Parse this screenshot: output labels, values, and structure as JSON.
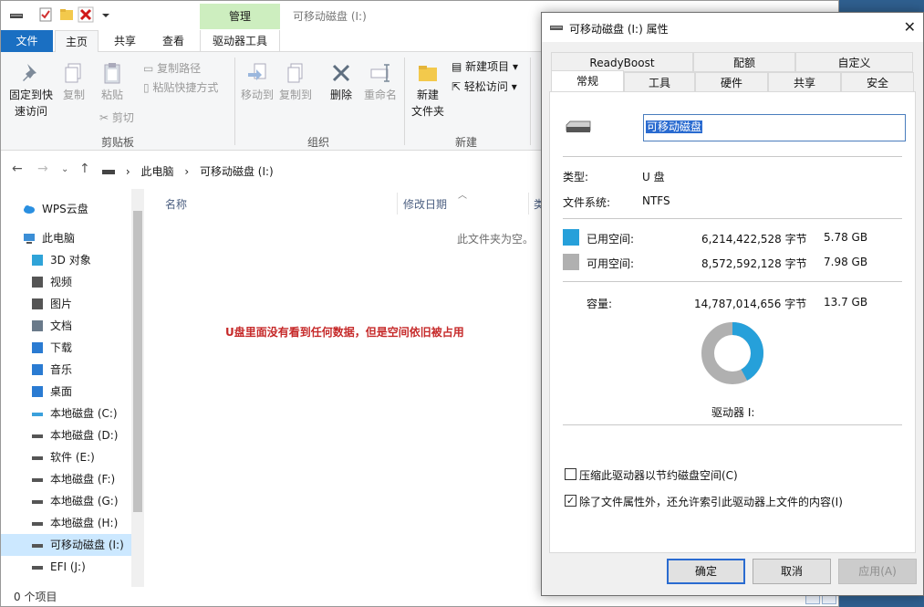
{
  "explorer": {
    "title": "可移动磁盘 (I:)",
    "manage_tab": "管理",
    "tabs": {
      "file": "文件",
      "home": "主页",
      "share": "共享",
      "view": "查看",
      "drive_tools": "驱动器工具"
    },
    "ribbon": {
      "clipboard": {
        "pin_line1": "固定到快",
        "pin_line2": "速访问",
        "copy": "复制",
        "paste": "粘贴",
        "copy_path": "复制路径",
        "paste_shortcut": "粘贴快捷方式",
        "cut": "剪切",
        "group_label": "剪贴板"
      },
      "organize": {
        "move_to": "移动到",
        "copy_to": "复制到",
        "delete": "删除",
        "rename": "重命名",
        "group_label": "组织"
      },
      "new": {
        "new_folder_line1": "新建",
        "new_folder_line2": "文件夹",
        "new_item": "新建项目",
        "easy_access": "轻松访问",
        "group_label": "新建"
      }
    },
    "address": {
      "segments": [
        "此电脑",
        "可移动磁盘 (I:)"
      ],
      "separator": "›"
    },
    "nav": {
      "wps": "WPS云盘",
      "this_pc": "此电脑",
      "items": [
        "3D 对象",
        "视频",
        "图片",
        "文档",
        "下载",
        "音乐",
        "桌面",
        "本地磁盘 (C:)",
        "本地磁盘 (D:)",
        "软件 (E:)",
        "本地磁盘 (F:)",
        "本地磁盘 (G:)",
        "本地磁盘 (H:)",
        "可移动磁盘 (I:)",
        "EFI (J:)"
      ]
    },
    "columns": {
      "name": "名称",
      "modified": "修改日期",
      "type": "类"
    },
    "empty_message": "此文件夹为空。",
    "annotation": "U盘里面没有看到任何数据，但是空间依旧被占用",
    "status": "0 个项目",
    "colors": {
      "file_tab": "#1a6fc2",
      "manage_tab": "#cdeebf",
      "annotation": "#c62a2a",
      "selected": "#cce8ff"
    }
  },
  "dialog": {
    "title": "可移动磁盘 (I:) 属性",
    "tabs_row1": [
      "ReadyBoost",
      "配额",
      "自定义"
    ],
    "tabs_row2": [
      "常规",
      "工具",
      "硬件",
      "共享",
      "安全"
    ],
    "active_tab": "常规",
    "drive_name": "可移动磁盘",
    "type_label": "类型:",
    "type_value": "U 盘",
    "fs_label": "文件系统:",
    "fs_value": "NTFS",
    "used": {
      "label": "已用空间:",
      "bytes": "6,214,422,528 字节",
      "size": "5.78 GB",
      "color": "#26a0da"
    },
    "free": {
      "label": "可用空间:",
      "bytes": "8,572,592,128 字节",
      "size": "7.98 GB",
      "color": "#b0b0b0"
    },
    "capacity": {
      "label": "容量:",
      "bytes": "14,787,014,656 字节",
      "size": "13.7 GB"
    },
    "used_fraction": 0.42,
    "drive_label": "驱动器 I:",
    "compress_label": "压缩此驱动器以节约磁盘空间(C)",
    "compress_checked": false,
    "index_label": "除了文件属性外，还允许索引此驱动器上文件的内容(I)",
    "index_checked": true,
    "buttons": {
      "ok": "确定",
      "cancel": "取消",
      "apply": "应用(A)"
    }
  }
}
